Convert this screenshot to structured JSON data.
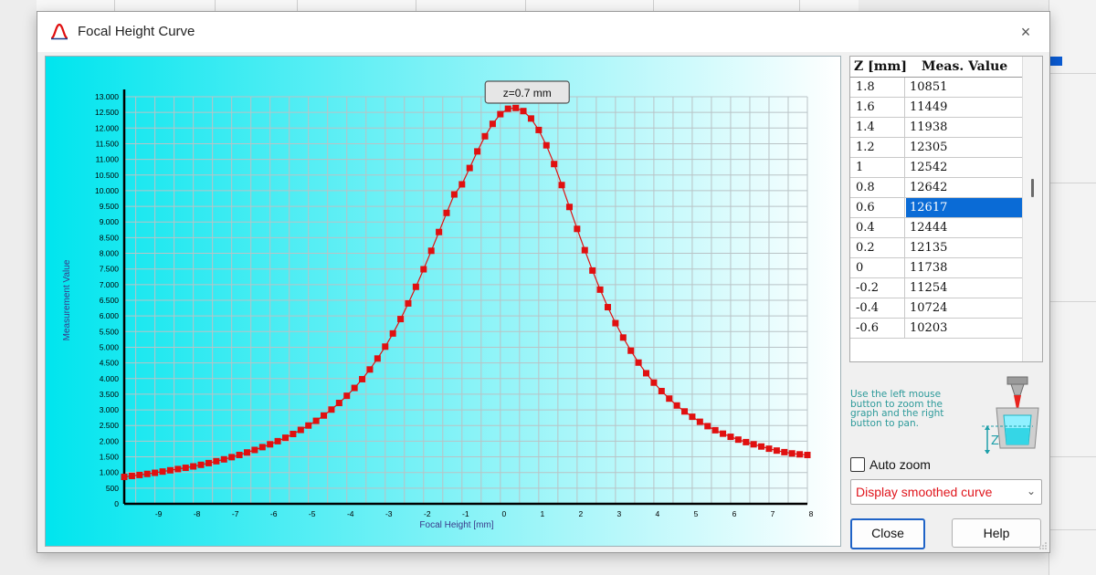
{
  "dialog": {
    "title": "Focal Height Curve",
    "close_glyph": "×",
    "icon": "focal-curve-app-icon"
  },
  "plot": {
    "tooltip": "z=0.7 mm"
  },
  "table": {
    "headers": [
      "Z [mm]",
      "Meas. Value"
    ],
    "rows": [
      {
        "z": "1.8",
        "value": "10851"
      },
      {
        "z": "1.6",
        "value": "11449"
      },
      {
        "z": "1.4",
        "value": "11938"
      },
      {
        "z": "1.2",
        "value": "12305"
      },
      {
        "z": "1",
        "value": "12542"
      },
      {
        "z": "0.8",
        "value": "12642"
      },
      {
        "z": "0.6",
        "value": "12617"
      },
      {
        "z": "0.4",
        "value": "12444"
      },
      {
        "z": "0.2",
        "value": "12135"
      },
      {
        "z": "0",
        "value": "11738"
      },
      {
        "z": "-0.2",
        "value": "11254"
      },
      {
        "z": "-0.4",
        "value": "10724"
      },
      {
        "z": "-0.6",
        "value": "10203"
      }
    ],
    "selected_index": 6
  },
  "hint": "Use the left mouse button to zoom the graph and the right button to pan.",
  "auto_zoom": {
    "label": "Auto zoom",
    "checked": false
  },
  "curve_select": {
    "value": "Display smoothed curve"
  },
  "buttons": {
    "close": "Close",
    "help": "Help"
  },
  "colors": {
    "curve": "#e01010",
    "accent": "#0a6bd6",
    "plot_bg_left": "#00e5ee",
    "plot_bg_right": "#ffffff",
    "select_text": "#e0151c"
  },
  "chart_data": {
    "type": "line",
    "title": "",
    "xlabel": "Focal Height [mm]",
    "ylabel": "Measurement Value",
    "xlim": [
      -9.8,
      8
    ],
    "ylim": [
      0,
      13000
    ],
    "x_ticks": [
      "-9",
      "-8",
      "-7",
      "-6",
      "-5",
      "-4",
      "-3",
      "-2",
      "-1",
      "0",
      "1",
      "2",
      "3",
      "4",
      "5",
      "6",
      "7",
      "8"
    ],
    "y_ticks": [
      "0",
      "500",
      "1.000",
      "1.500",
      "2.000",
      "2.500",
      "3.000",
      "3.500",
      "4.000",
      "4.500",
      "5.000",
      "5.500",
      "6.000",
      "6.500",
      "7.000",
      "7.500",
      "8.000",
      "8.500",
      "9.000",
      "9.500",
      "10.000",
      "10.500",
      "11.000",
      "11.500",
      "12.000",
      "12.500",
      "13.000"
    ],
    "grid": true,
    "series": [
      {
        "x": [
          -9.8,
          -9.6,
          -9.4,
          -9.2,
          -9.0,
          -8.8,
          -8.6,
          -8.4,
          -8.2,
          -8.0,
          -7.8,
          -7.6,
          -7.4,
          -7.2,
          -7.0,
          -6.8,
          -6.6,
          -6.4,
          -6.2,
          -6.0,
          -5.8,
          -5.6,
          -5.4,
          -5.2,
          -5.0,
          -4.8,
          -4.6,
          -4.4,
          -4.2,
          -4.0,
          -3.8,
          -3.6,
          -3.4,
          -3.2,
          -3.0,
          -2.8,
          -2.6,
          -2.4,
          -2.2,
          -2.0,
          -1.8,
          -1.6,
          -1.4,
          -1.2,
          -1.0,
          -0.8,
          -0.6,
          -0.4,
          -0.2,
          0.0,
          0.2,
          0.4,
          0.6,
          0.8,
          1.0,
          1.2,
          1.4,
          1.6,
          1.8,
          2.0,
          2.2,
          2.4,
          2.6,
          2.8,
          3.0,
          3.2,
          3.4,
          3.6,
          3.8,
          4.0,
          4.2,
          4.4,
          4.6,
          4.8,
          5.0,
          5.2,
          5.4,
          5.6,
          5.8,
          6.0,
          6.2,
          6.4,
          6.6,
          6.8,
          7.0,
          7.2,
          7.4,
          7.6,
          7.8,
          8.0
        ],
        "y": [
          860,
          890,
          920,
          955,
          990,
          1030,
          1070,
          1110,
          1150,
          1195,
          1245,
          1300,
          1360,
          1420,
          1490,
          1560,
          1640,
          1720,
          1810,
          1900,
          2000,
          2110,
          2230,
          2360,
          2500,
          2650,
          2820,
          3010,
          3220,
          3450,
          3700,
          3980,
          4290,
          4640,
          5020,
          5440,
          5900,
          6400,
          6930,
          7490,
          8080,
          8680,
          9290,
          9880,
          10203,
          10724,
          11254,
          11738,
          12135,
          12444,
          12617,
          12642,
          12542,
          12305,
          11938,
          11449,
          10851,
          10180,
          9480,
          8780,
          8100,
          7450,
          6840,
          6280,
          5770,
          5310,
          4890,
          4510,
          4170,
          3870,
          3600,
          3360,
          3140,
          2950,
          2780,
          2620,
          2480,
          2350,
          2240,
          2140,
          2050,
          1970,
          1900,
          1830,
          1760,
          1700,
          1650,
          1610,
          1580,
          1560
        ]
      }
    ]
  }
}
